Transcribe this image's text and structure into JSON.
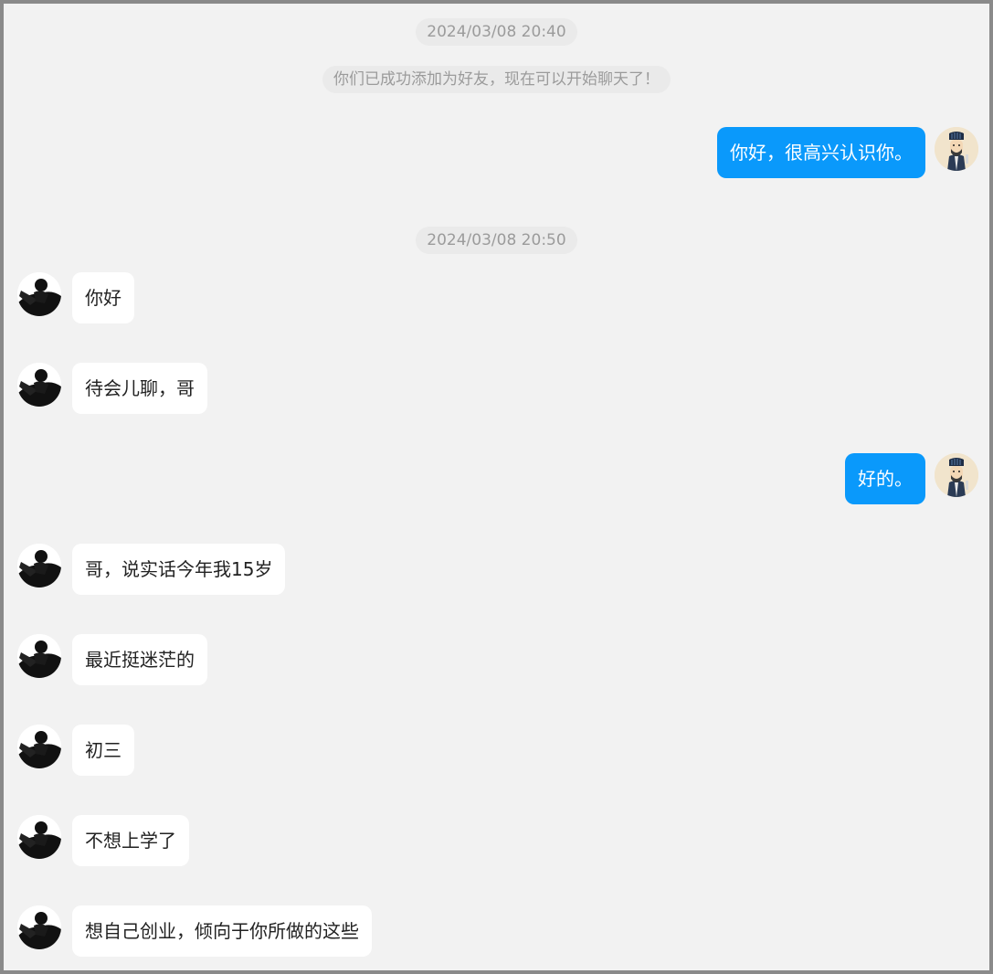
{
  "timestamps": [
    "2024/03/08 20:40",
    "2024/03/08 20:50"
  ],
  "system_notice": "你们已成功添加为好友，现在可以开始聊天了！",
  "messages": [
    {
      "side": "right",
      "text": "你好，很高兴认识你。"
    },
    {
      "side": "left",
      "text": "你好"
    },
    {
      "side": "left",
      "text": "待会儿聊，哥"
    },
    {
      "side": "right",
      "text": "好的。"
    },
    {
      "side": "left",
      "text": "哥，说实话今年我15岁"
    },
    {
      "side": "left",
      "text": "最近挺迷茫的"
    },
    {
      "side": "left",
      "text": "初三"
    },
    {
      "side": "left",
      "text": "不想上学了"
    },
    {
      "side": "left",
      "text": "想自己创业，倾向于你所做的这些"
    }
  ],
  "colors": {
    "background": "#f2f2f2",
    "sent_bubble": "#0a99fb",
    "received_bubble": "#ffffff",
    "system_text": "#9b9b9b"
  }
}
